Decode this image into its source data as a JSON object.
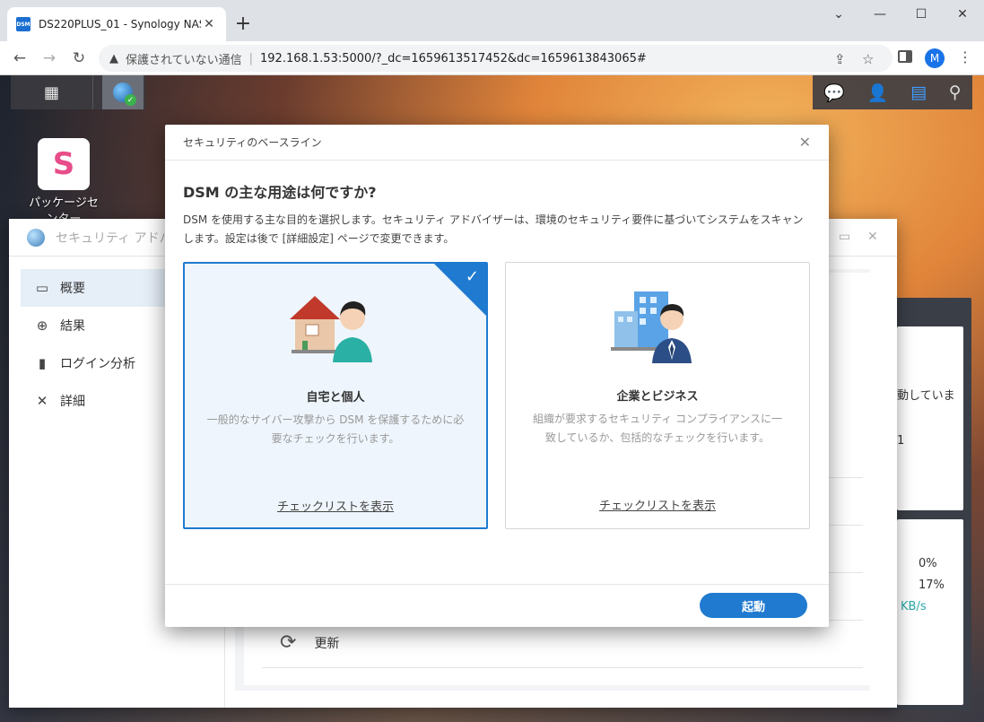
{
  "browser": {
    "tab_title": "DS220PLUS_01 - Synology NAS",
    "favicon_text": "DSM",
    "insecure_label": "保護されていない通信",
    "url": "192.168.1.53:5000/?_dc=1659613517452&dc=1659613843065#",
    "profile_initial": "M"
  },
  "desktop": {
    "package_center_label": "パッケージセンター",
    "package_icon_letter": "S"
  },
  "security_window": {
    "title": "セキュリティ アドバイザー",
    "sidebar": [
      {
        "label": "概要",
        "icon": "overview-icon"
      },
      {
        "label": "結果",
        "icon": "target-icon"
      },
      {
        "label": "ログイン分析",
        "icon": "bar-chart-icon"
      },
      {
        "label": "詳細",
        "icon": "tools-icon"
      }
    ],
    "refresh_label": "更新"
  },
  "widget": {
    "text_running": "動していま",
    "value_1": "1",
    "value_2": "/",
    "cpu": "0%",
    "ram": "17%",
    "unit": "KB/s"
  },
  "modal": {
    "header": "セキュリティのベースライン",
    "question": "DSM の主な用途は何ですか?",
    "description": "DSM を使用する主な目的を選択します。セキュリティ アドバイザーは、環境のセキュリティ要件に基づいてシステムをスキャンします。設定は後で [詳細設定] ページで変更できます。",
    "options": [
      {
        "title": "自宅と個人",
        "description": "一般的なサイバー攻撃から DSM を保護するために必要なチェックを行います。",
        "link": "チェックリストを表示",
        "selected": true
      },
      {
        "title": "企業とビジネス",
        "description": "組織が要求するセキュリティ コンプライアンスに一致しているか、包括的なチェックを行います。",
        "link": "チェックリストを表示",
        "selected": false
      }
    ],
    "launch_label": "起動"
  },
  "colors": {
    "accent": "#1f7ad0",
    "selected_bg": "#eef5fc"
  }
}
